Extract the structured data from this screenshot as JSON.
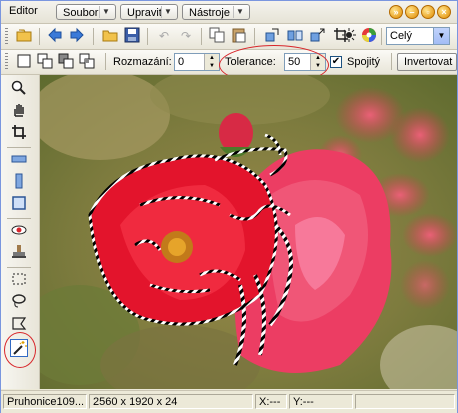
{
  "app": {
    "title": "Editor"
  },
  "menus": [
    "Soubor",
    "Upravit",
    "Nástroje"
  ],
  "toolbar1": {
    "icons": [
      "open-icon",
      "back-icon",
      "forward-icon",
      "folder-icon",
      "save-icon",
      "undo-icon",
      "redo-icon",
      "copy-icon",
      "paste-icon",
      "rotate-icon",
      "flip-icon",
      "resize-icon",
      "crop-icon",
      "effect-icon",
      "color-wheel-icon"
    ],
    "zoom_select": "Celý"
  },
  "toolbar2": {
    "blur_label": "Rozmazání:",
    "blur_value": "0",
    "tolerance_label": "Tolerance:",
    "tolerance_value": "50",
    "contiguous_checked": "✔",
    "contiguous_label": "Spojitý",
    "invert_button": "Invertovat"
  },
  "left_tools": [
    "zoom-icon",
    "hand-icon",
    "crop-tool-icon",
    "straighten-icon",
    "resize-tool-icon",
    "frame-icon",
    "red-eye-icon",
    "stamp-icon",
    "rect-select-icon",
    "lasso-icon",
    "polygon-lasso-icon",
    "magic-wand-icon"
  ],
  "status": {
    "filename": "Pruhonice109...",
    "dimensions": "2560 x 1920 x 24",
    "x": "X:---",
    "y": "Y:---"
  }
}
